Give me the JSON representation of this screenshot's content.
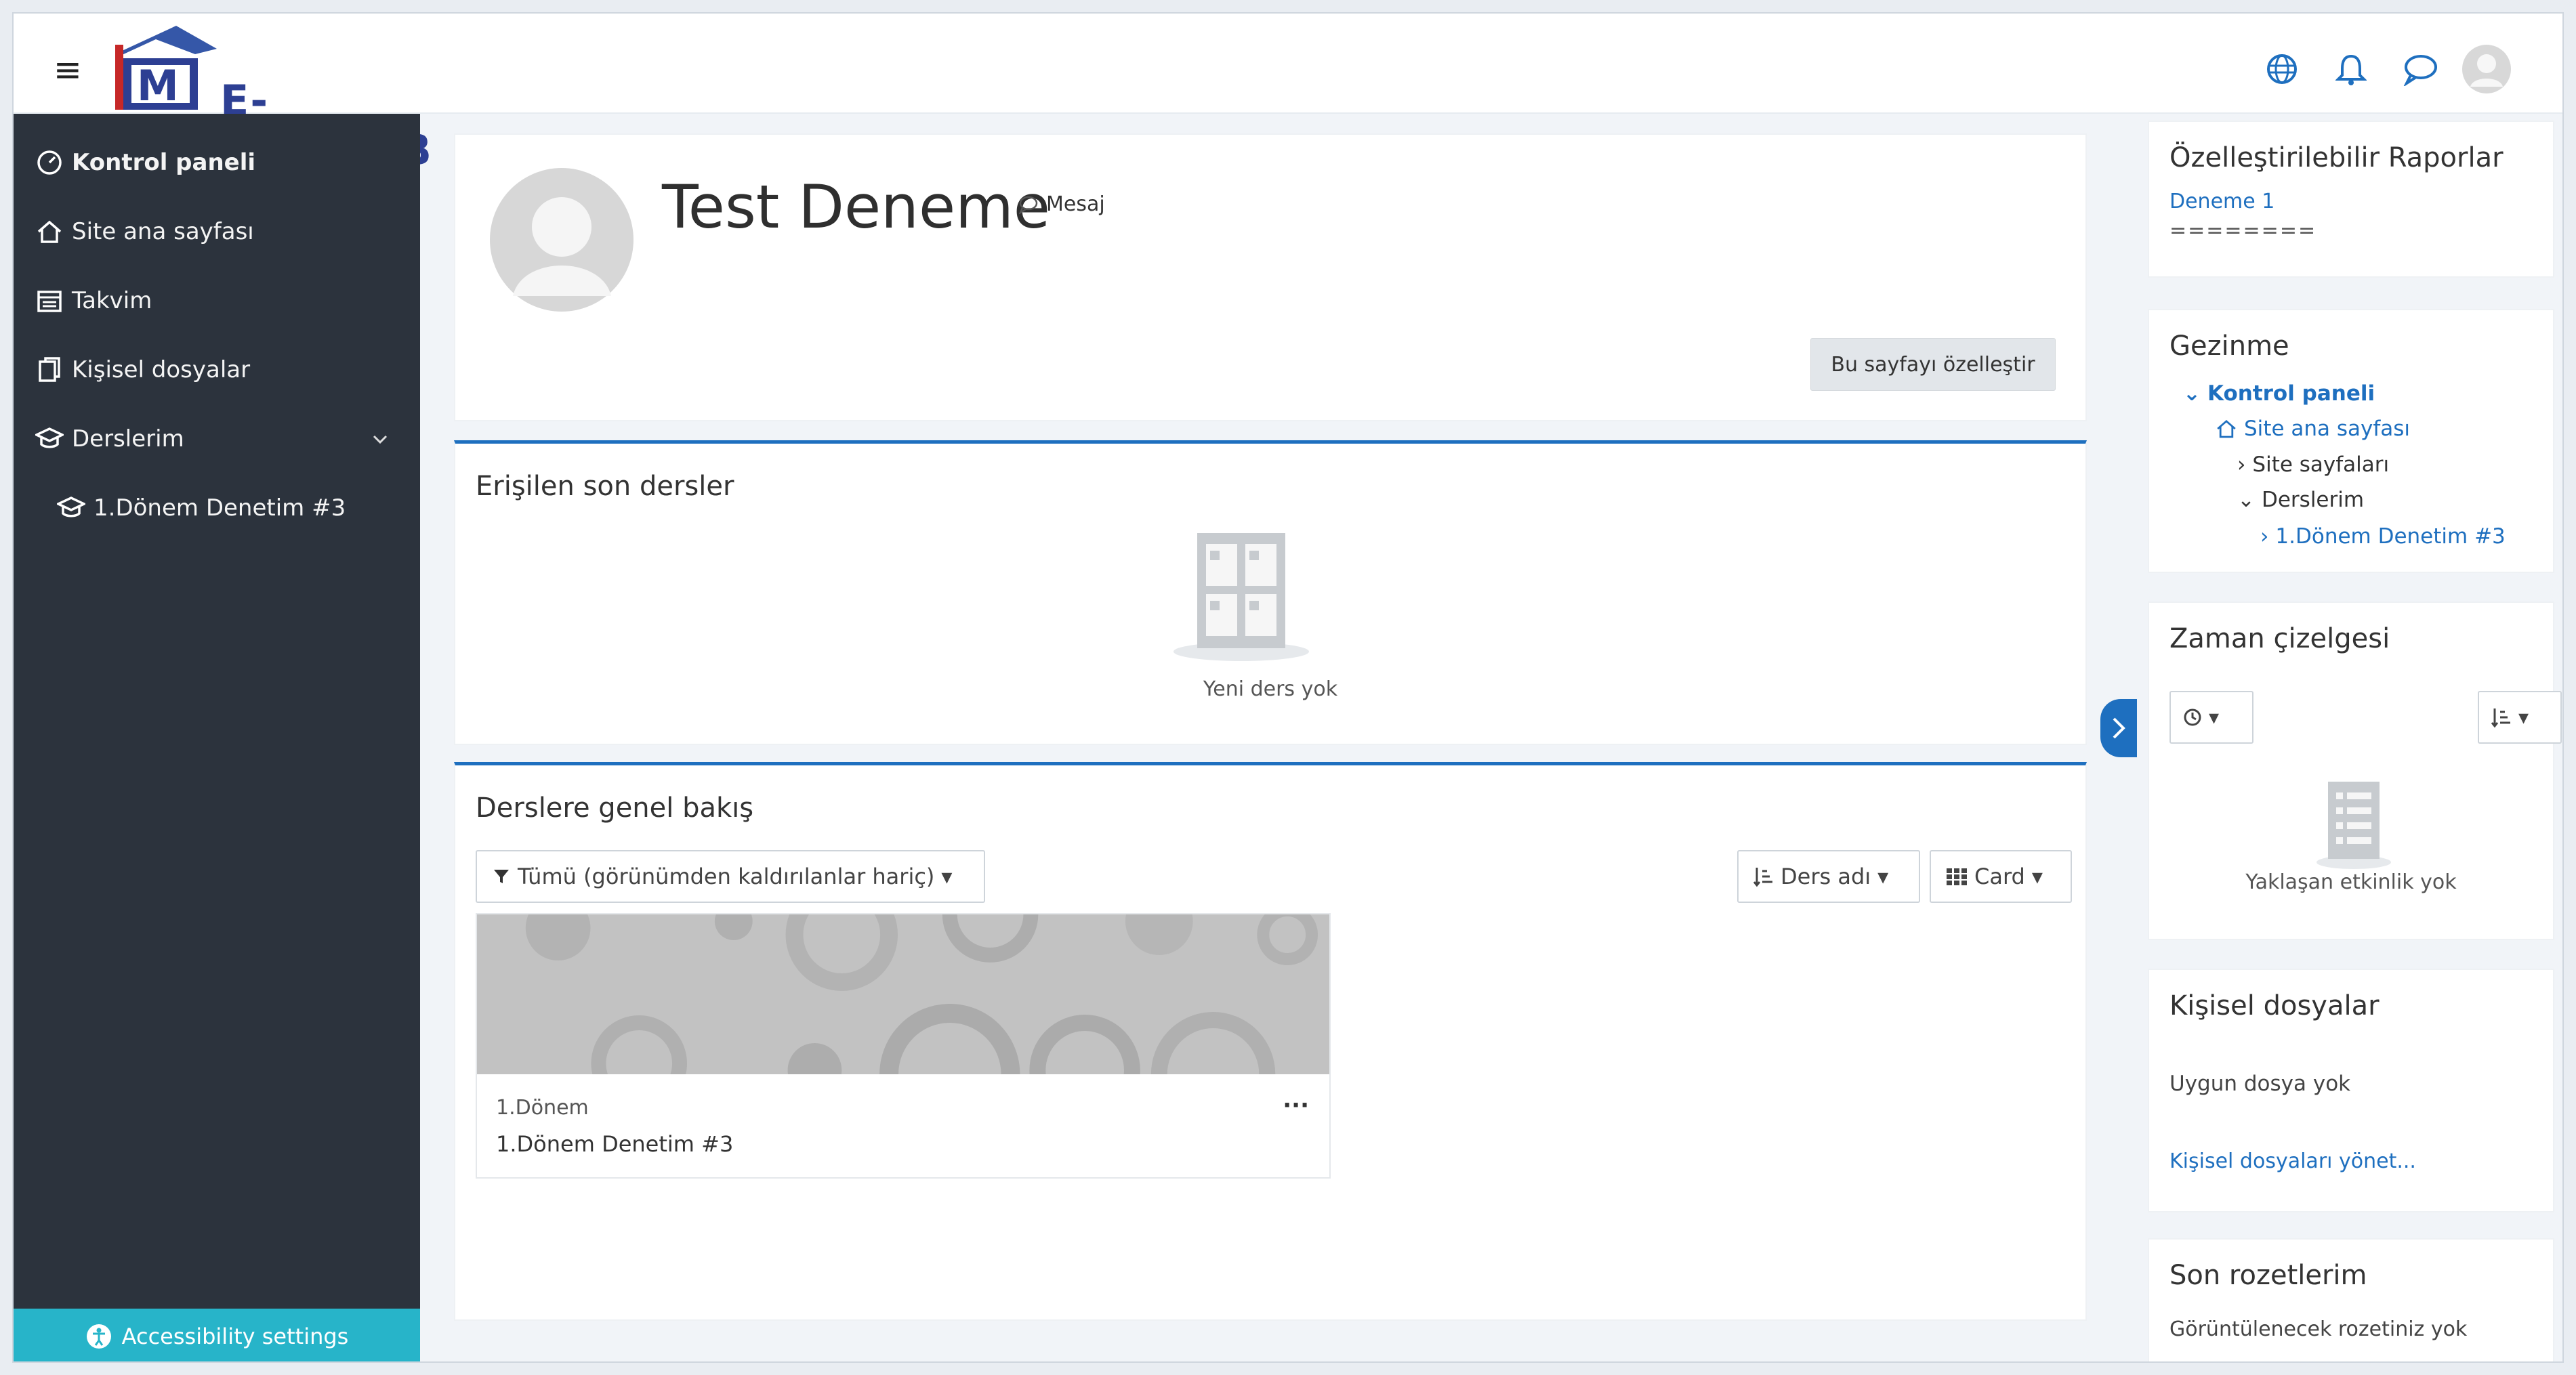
{
  "header": {
    "logo_text": "E-TÜRMOB",
    "logo_letter": "M",
    "icons": [
      "globe-icon",
      "bell-icon",
      "chat-icon",
      "user-avatar"
    ]
  },
  "sidebar": {
    "items": [
      {
        "label": "Kontrol paneli",
        "icon": "dashboard-icon"
      },
      {
        "label": "Site ana sayfası",
        "icon": "home-icon"
      },
      {
        "label": "Takvim",
        "icon": "calendar-icon"
      },
      {
        "label": "Kişisel dosyalar",
        "icon": "files-icon"
      },
      {
        "label": "Derslerim",
        "icon": "graduation-cap-icon"
      },
      {
        "label": "1.Dönem Denetim #3",
        "icon": "graduation-cap-icon"
      }
    ],
    "accessibility": "Accessibility settings"
  },
  "profile": {
    "name": "Test Deneme",
    "message_label": "Mesaj",
    "customize_label": "Bu sayfayı özelleştir"
  },
  "recent": {
    "title": "Erişilen son dersler",
    "empty_text": "Yeni ders yok"
  },
  "overview": {
    "title": "Derslere genel bakış",
    "filter_label": "Tümü (görünümden kaldırılanlar hariç)",
    "sort_label": "Ders adı",
    "view_label": "Card",
    "course": {
      "category": "1.Dönem",
      "name": "1.Dönem Denetim #3",
      "menu": "···"
    }
  },
  "right": {
    "reports": {
      "title": "Özelleştirilebilir Raporlar",
      "link": "Deneme 1",
      "separator": "========"
    },
    "navigation": {
      "title": "Gezinme",
      "items": [
        {
          "label": "Kontrol paneli",
          "marker": "⌄"
        },
        {
          "label": "Site ana sayfası",
          "marker": ""
        },
        {
          "label": "Site sayfaları",
          "marker": "›"
        },
        {
          "label": "Derslerim",
          "marker": "⌄"
        },
        {
          "label": "1.Dönem Denetim #3",
          "marker": "›"
        }
      ]
    },
    "timeline": {
      "title": "Zaman çizelgesi",
      "empty_text": "Yaklaşan etkinlik yok"
    },
    "files": {
      "title": "Kişisel dosyalar",
      "empty_text": "Uygun dosya yok",
      "manage_link": "Kişisel dosyaları yönet..."
    },
    "badges": {
      "title": "Son rozetlerim",
      "empty_text": "Görüntülenecek rozetiniz yok"
    }
  },
  "colors": {
    "sidebar_bg": "#2c333d",
    "accent": "#1e6fbf",
    "accessibility_bg": "#27b4c9"
  }
}
